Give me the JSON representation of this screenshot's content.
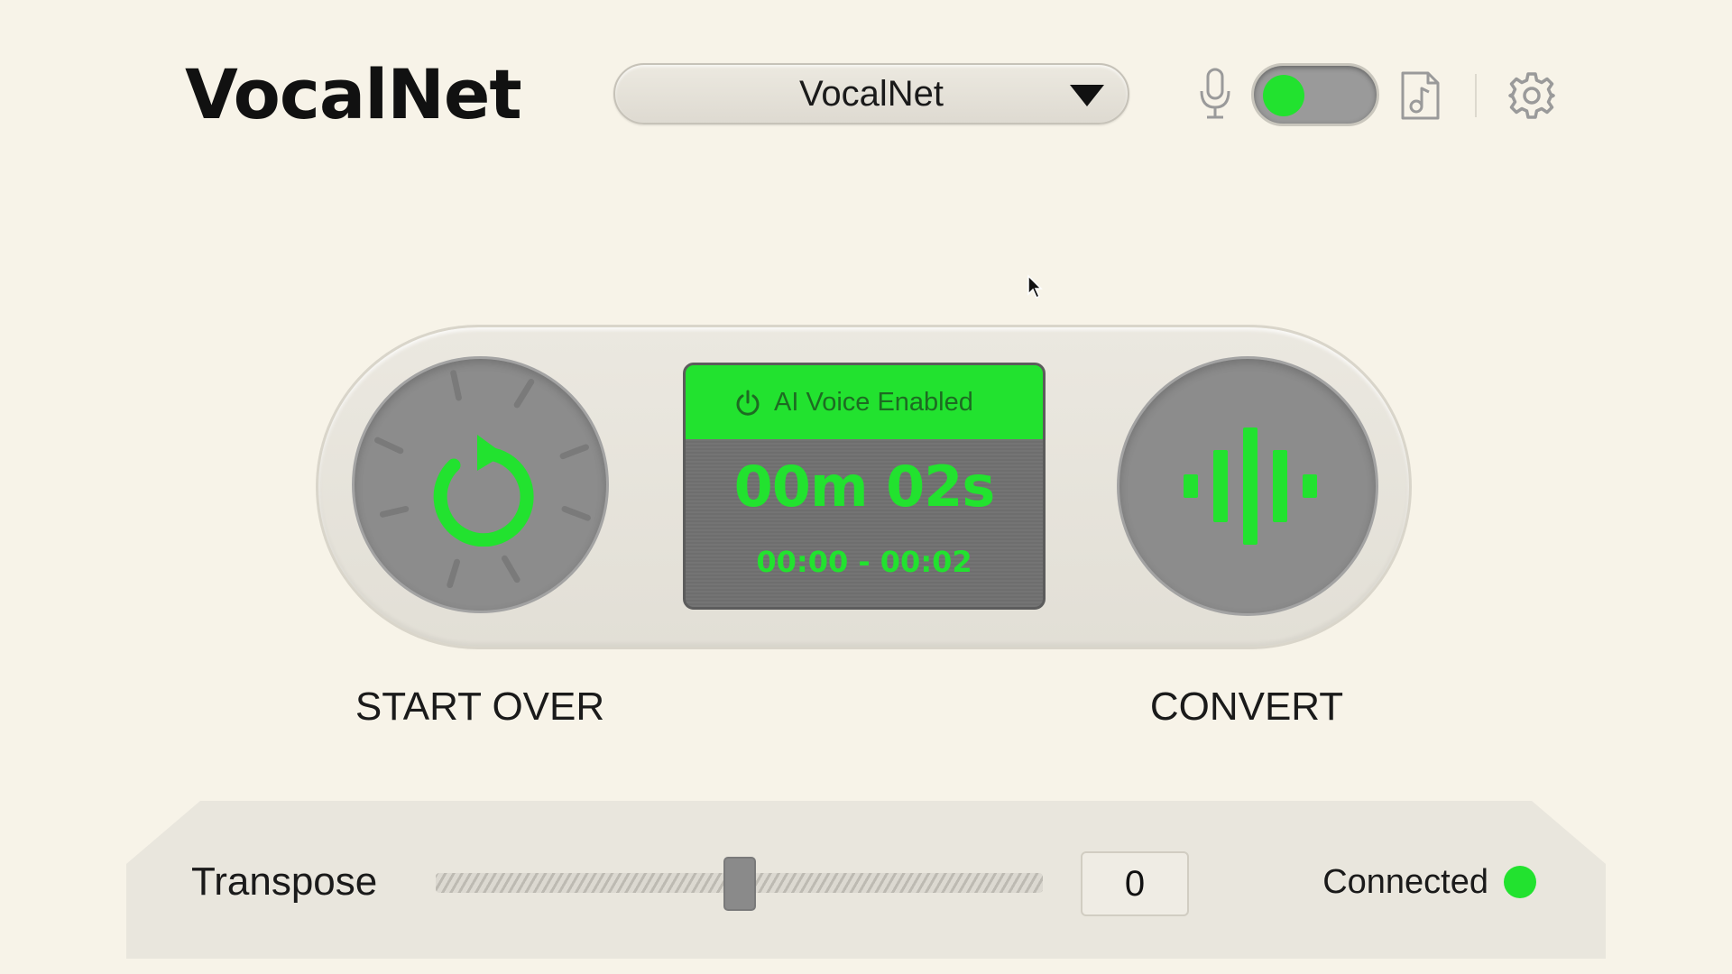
{
  "header": {
    "app_title": "VocalNet",
    "model_select": {
      "selected": "VocalNet"
    },
    "mic_toggle": {
      "on": true
    },
    "icons": [
      "microphone-icon",
      "music-file-icon",
      "gear-icon"
    ]
  },
  "controls": {
    "start_over_label": "START OVER",
    "convert_label": "CONVERT",
    "display": {
      "status": "AI Voice Enabled",
      "elapsed": "00m 02s",
      "range": "00:00 - 00:02"
    }
  },
  "bottom": {
    "transpose_label": "Transpose",
    "transpose_value": "0",
    "transpose_level": 0.5,
    "connection_status": "Connected"
  },
  "colors": {
    "accent": "#22e22f",
    "background": "#f7f3e8",
    "knob": "#8c8c8c"
  }
}
